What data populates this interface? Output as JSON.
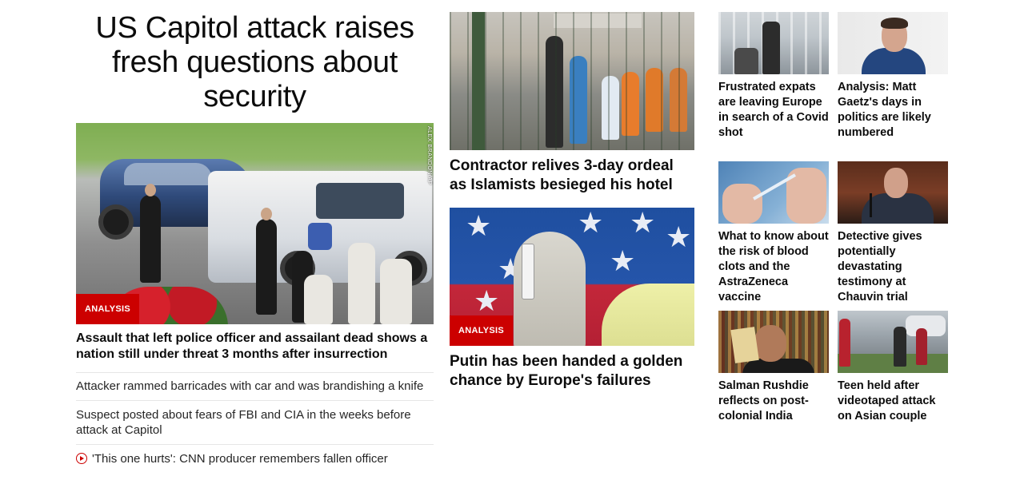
{
  "top_story": {
    "headline": "US Capitol attack raises fresh questions about security",
    "image_alt": "Tow truck removing car at US Capitol barricade",
    "image_credit": "ALEX BRANDON/AP",
    "tag": "ANALYSIS",
    "lead": "Assault that left police officer and assailant dead shows a nation still under threat 3 months after insurrection",
    "related": [
      {
        "text": "Attacker rammed barricades with car and was brandishing a knife",
        "video": false
      },
      {
        "text": "Suspect posted about fears of FBI and CIA in the weeks before attack at Capitol",
        "video": false
      },
      {
        "text": "'This one hurts': CNN producer remembers fallen officer",
        "video": true
      }
    ]
  },
  "middle": [
    {
      "title": "Contractor relives 3-day ordeal as Islamists besieged his hotel",
      "tag": ""
    },
    {
      "title": "Putin has been handed a golden chance by Europe's failures",
      "tag": "ANALYSIS"
    }
  ],
  "grid": [
    {
      "title": "Frustrated expats are leaving Europe in search of a Covid shot",
      "icon": "airport-photo"
    },
    {
      "title": "Analysis: Matt Gaetz's days in politics are likely numbered",
      "icon": "portrait-photo"
    },
    {
      "title": "What to know about the risk of blood clots and the AstraZeneca vaccine",
      "icon": "vaccine-photo"
    },
    {
      "title": "Detective gives potentially devastating testimony at Chauvin trial",
      "icon": "courtroom-photo"
    },
    {
      "title": "Salman Rushdie reflects on post-colonial India",
      "icon": "portrait-photo"
    },
    {
      "title": "Teen held after videotaped attack on Asian couple",
      "icon": "street-photo"
    }
  ],
  "colors": {
    "accent": "#cc0000",
    "text": "#0c0c0c",
    "divider": "#e6e6e6"
  }
}
